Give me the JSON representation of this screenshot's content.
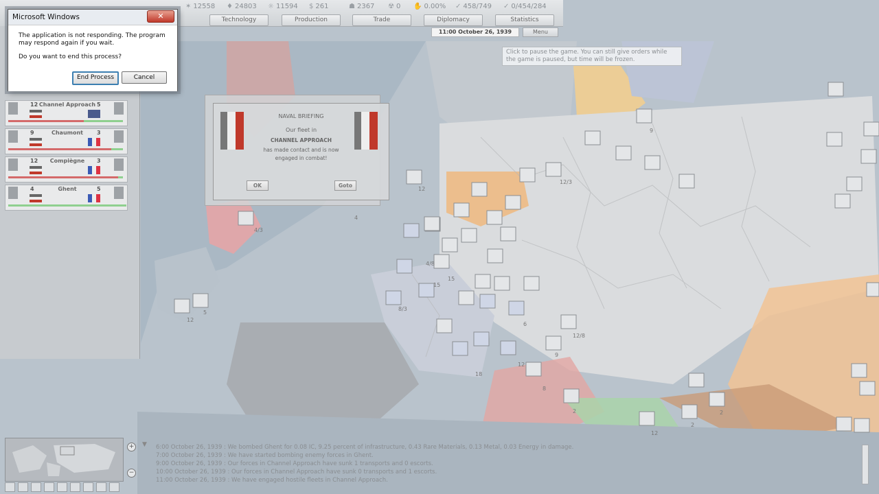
{
  "topbar": {
    "resources": [
      {
        "icon": "manpower-icon",
        "value": "12558"
      },
      {
        "icon": "supplies-icon",
        "value": "24803"
      },
      {
        "icon": "oil-icon",
        "value": "11594"
      },
      {
        "icon": "money-icon",
        "value": "261"
      },
      {
        "icon": "transport-icon",
        "value": "2367"
      },
      {
        "icon": "nuclear-icon",
        "value": "0"
      },
      {
        "icon": "dissent-icon",
        "value": "0.00%"
      },
      {
        "icon": "leadership-icon",
        "value": "458/749"
      },
      {
        "icon": "units-icon",
        "value": "0/454/284"
      }
    ],
    "tabs": [
      "Technology",
      "Production",
      "Trade",
      "Diplomacy",
      "Statistics"
    ],
    "date": "11:00 October 26, 1939",
    "menu_label": "Menu"
  },
  "tooltip": "Click to pause the game. You can still give orders while the game is paused, but time will be frozen.",
  "dialog": {
    "title": "Microsoft Windows",
    "close_label": "✕",
    "message1": "The application is not responding. The program may respond again if you wait.",
    "message2": "Do you want to end this process?",
    "end_label": "End Process",
    "cancel_label": "Cancel"
  },
  "combats": [
    {
      "n1": "12",
      "name": "Channel Approach",
      "n2": "5",
      "right_flag": "uk"
    },
    {
      "n1": "9",
      "name": "Chaumont",
      "n2": "3",
      "right_flag": "fr"
    },
    {
      "n1": "12",
      "name": "Compiègne",
      "n2": "3",
      "right_flag": "fr"
    },
    {
      "n1": "4",
      "name": "Ghent",
      "n2": "5",
      "right_flag": "fr"
    }
  ],
  "briefing": {
    "title": "NAVAL BRIEFING",
    "line1": "Our fleet in",
    "location": "CHANNEL APPROACH",
    "line2": "has made contact and is now",
    "line3": "engaged in combat!",
    "ok_label": "OK",
    "goto_label": "Goto"
  },
  "log": [
    "6:00 October 26, 1939 : We bombed Ghent for 0.08 IC, 9.25 percent of infrastructure, 0.43 Rare Materials, 0.13 Metal, 0.03 Energy in damage.",
    "7:00 October 26, 1939 : We have started bombing enemy forces in Ghent.",
    "9:00 October 26, 1939 : Our forces in Channel Approach have sunk 1 transports and 0 escorts.",
    "10:00 October 26, 1939 : Our forces in Channel Approach have sunk 0 transports and 1 escorts.",
    "11:00 October 26, 1939 : We have engaged hostile fleets in Channel Approach."
  ],
  "map_unit_labels": [
    "12",
    "12/3",
    "4/3",
    "4",
    "12",
    "5",
    "8/3",
    "4/8",
    "15",
    "15",
    "6",
    "12/8",
    "9",
    "18",
    "12",
    "8",
    "2",
    "2",
    "12",
    "2",
    "9"
  ]
}
